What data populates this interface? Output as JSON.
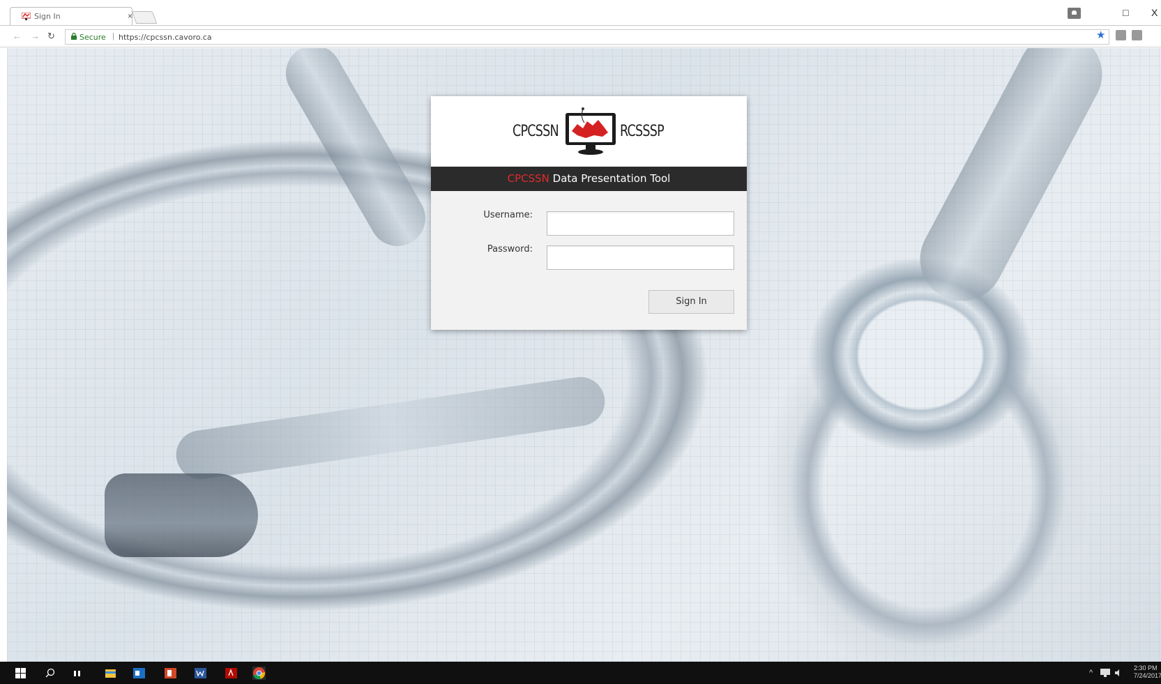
{
  "browser": {
    "tab_title": "Sign In",
    "tab_close": "×",
    "window_controls": {
      "restore": "□",
      "close": "X"
    },
    "address": {
      "secure_label": "Secure",
      "separator": "|",
      "url": "https://cpcssn.cavoro.ca"
    },
    "icons": [
      "back-icon",
      "forward-icon",
      "reload-icon",
      "lock-icon",
      "bookmark-star-icon",
      "extension-icon"
    ]
  },
  "login": {
    "logo_left": "CPCSSN",
    "logo_right": "RCSSSP",
    "banner_highlight": "CPCSSN",
    "banner_text": " Data Presentation Tool",
    "username_label": "Username:",
    "password_label": "Password:",
    "username_value": "",
    "password_value": "",
    "signin_label": "Sign In"
  },
  "taskbar": {
    "clock_time": "2:30 PM",
    "clock_date": "7/24/2017",
    "apps": [
      "start-icon",
      "search-icon",
      "task-view-icon",
      "file-explorer-icon",
      "outlook-icon",
      "powerpoint-icon",
      "word-icon",
      "acrobat-icon",
      "chrome-icon"
    ]
  },
  "colors": {
    "banner_bg": "#2b2b2b",
    "banner_accent": "#e02a2a",
    "taskbar_bg": "#101010",
    "star": "#2f6fd6"
  }
}
